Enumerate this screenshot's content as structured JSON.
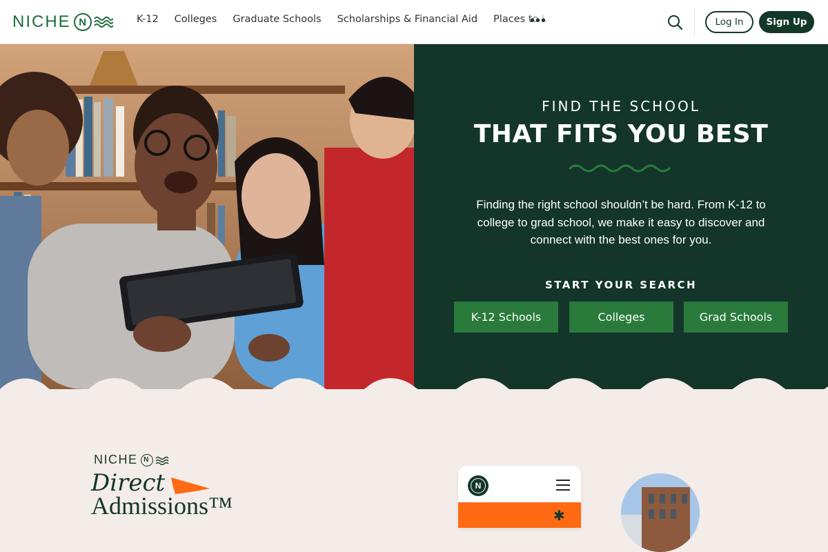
{
  "header": {
    "logo_text": "NICHE",
    "logo_mark": "N",
    "nav": [
      "K-12",
      "Colleges",
      "Graduate Schools",
      "Scholarships & Financial Aid",
      "Places to Li"
    ],
    "more_label": "•••",
    "login_label": "Log In",
    "signup_label": "Sign Up",
    "icons": {
      "search": "search-icon",
      "more": "more-dots-icon"
    }
  },
  "hero": {
    "kicker": "FIND THE SCHOOL",
    "headline": "THAT FITS YOU BEST",
    "description": "Finding the right school shouldn’t be hard. From K-12 to college to grad school, we make it easy to discover and connect with the best ones for you.",
    "start_label": "START YOUR SEARCH",
    "buttons": [
      "K-12 Schools",
      "Colleges",
      "Grad Schools"
    ]
  },
  "direct_admissions": {
    "brand": "NICHE",
    "brand_mark": "N",
    "title_line1": "Direct",
    "title_line2": "Admissions™",
    "phone_logo": "N"
  },
  "colors": {
    "brand_green": "#1e6c3c",
    "dark_green": "#13352a",
    "cta_green": "#2a7a3b",
    "cream": "#f3ece8",
    "orange": "#ff6a13"
  }
}
